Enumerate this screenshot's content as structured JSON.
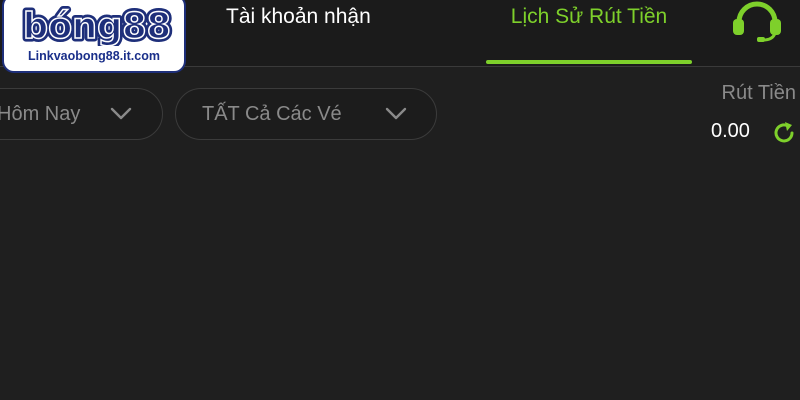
{
  "logo": {
    "text": "bóng88",
    "url_text": "Linkvaobong88.it.com"
  },
  "tabs": [
    {
      "label": "Tài khoản nhận",
      "active": false
    },
    {
      "label": "Lịch Sử Rút Tiền",
      "active": true
    }
  ],
  "icons": {
    "support": "headset-icon",
    "refresh": "refresh-icon",
    "chevron": "chevron-down-icon"
  },
  "filters": {
    "date": {
      "label": "Hôm Nay"
    },
    "ticket": {
      "label": "TẤT Cả Các Vé"
    }
  },
  "withdraw": {
    "label": "Rút Tiền",
    "amount": "0.00"
  },
  "colors": {
    "accent": "#7ed02b",
    "background": "#1f1f1f",
    "logo_blue": "#1e2f7a"
  }
}
